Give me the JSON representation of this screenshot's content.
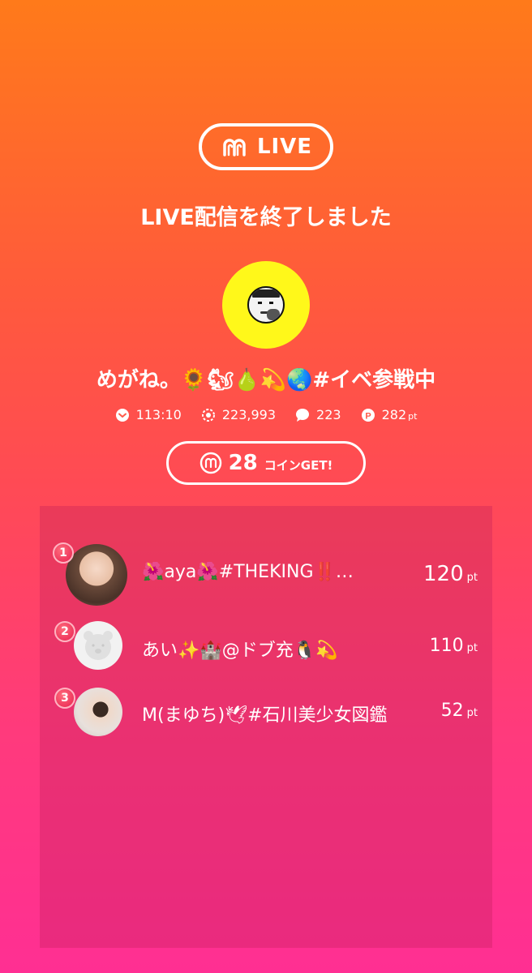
{
  "header": {
    "logo_text": "LIVE",
    "title": "LIVE配信を終了しました"
  },
  "streamer": {
    "name": "めがね。🌻🐿🍐💫🌏#イベ参戦中",
    "avatar_bg": "#fff81a"
  },
  "stats": {
    "duration": "113:10",
    "viewers": "223,993",
    "comments": "223",
    "points": "282",
    "points_unit": "pt"
  },
  "coins": {
    "count": "28",
    "label": "コインGET!"
  },
  "ranking": [
    {
      "rank": "1",
      "name": "🌺aya🌺#THEKING‼️…",
      "points": "120",
      "unit": "pt"
    },
    {
      "rank": "2",
      "name": "あい✨🏰@ドブ充🐧💫",
      "points": "110",
      "unit": "pt"
    },
    {
      "rank": "3",
      "name": "M(まゆち)🕊#石川美少女図鑑",
      "points": "52",
      "unit": "pt"
    }
  ],
  "colors": {
    "gradient_top": "#ff7a1a",
    "gradient_bottom": "#ff2f93",
    "badge": "#e8204f"
  }
}
